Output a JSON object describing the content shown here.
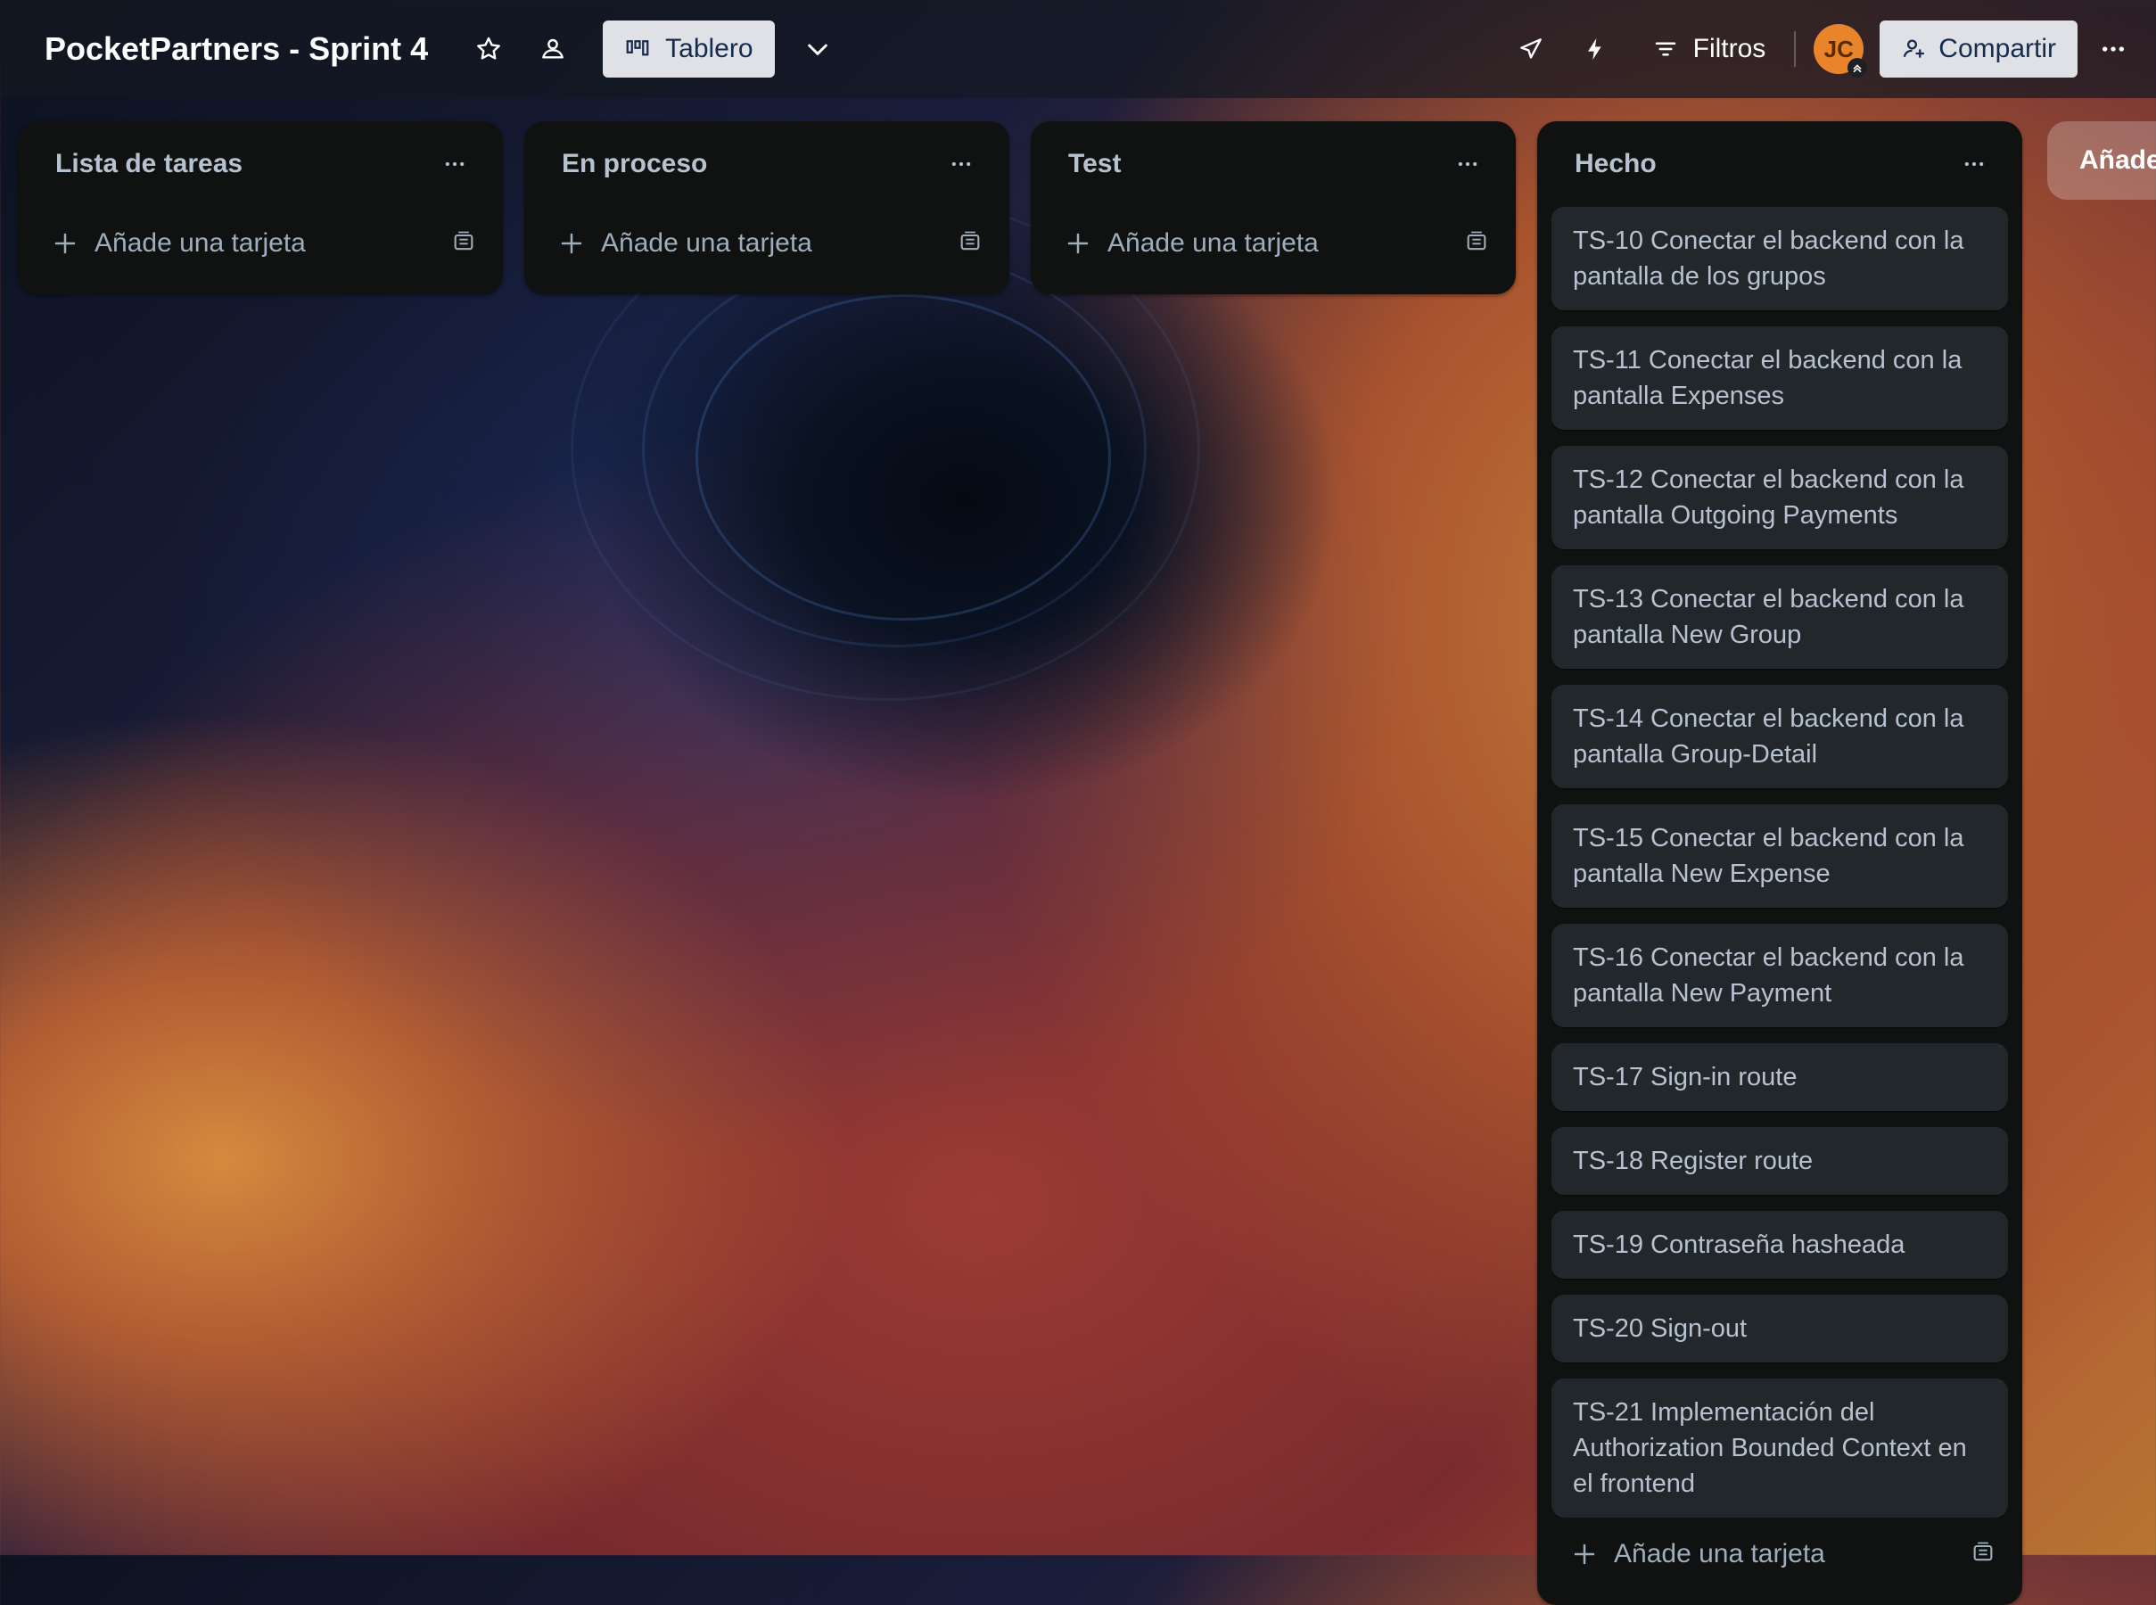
{
  "board": {
    "title": "PocketPartners - Sprint 4",
    "view_label": "Tablero"
  },
  "header": {
    "filters_label": "Filtros",
    "avatar_initials": "JC",
    "share_label": "Compartir"
  },
  "lists": [
    {
      "title": "Lista de tareas",
      "add_card_label": "Añade una tarjeta",
      "cards": []
    },
    {
      "title": "En proceso",
      "add_card_label": "Añade una tarjeta",
      "cards": []
    },
    {
      "title": "Test",
      "add_card_label": "Añade una tarjeta",
      "cards": []
    },
    {
      "title": "Hecho",
      "add_card_label": "Añade una tarjeta",
      "cards": [
        "TS-10 Conectar el backend con la pantalla de los grupos",
        "TS-11 Conectar el backend con la pantalla Expenses",
        "TS-12 Conectar el backend con la pantalla Outgoing Payments",
        "TS-13 Conectar el backend con la pantalla New Group",
        "TS-14 Conectar el backend con la pantalla Group-Detail",
        "TS-15 Conectar el backend con la pantalla New Expense",
        "TS-16 Conectar el backend con la pantalla New Payment",
        "TS-17 Sign-in route",
        "TS-18 Register route",
        "TS-19 Contraseña hasheada",
        "TS-20 Sign-out",
        "TS-21 Implementación del Authorization Bounded Context en el frontend"
      ]
    }
  ],
  "add_list_label": "Añade otra lista",
  "icons": {
    "star": "star-icon",
    "visibility": "team-visibility-icon",
    "board": "board-view-icon",
    "chevron": "chevron-down-icon",
    "rocket": "power-ups-icon",
    "bolt": "automation-icon",
    "filter": "filter-icon",
    "share": "add-member-icon",
    "more": "more-icon",
    "plus": "plus-icon",
    "template": "card-template-icon"
  },
  "colors": {
    "header_bg": "#141821",
    "list_bg": "#0f1210",
    "card_bg": "#22272b",
    "text": "#b6c2cf",
    "avatar": "#e8842a",
    "button_bg": "#dfe1e6"
  }
}
